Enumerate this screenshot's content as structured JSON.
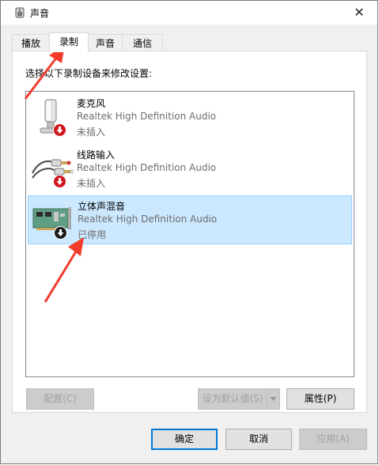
{
  "window": {
    "title": "声音",
    "close_glyph": "✕"
  },
  "tabs": [
    {
      "label": "播放"
    },
    {
      "label": "录制"
    },
    {
      "label": "声音"
    },
    {
      "label": "通信"
    }
  ],
  "active_tab": "录制",
  "recording": {
    "instructions": "选择以下录制设备来修改设置:",
    "devices": [
      {
        "name": "麦克风",
        "description": "Realtek High Definition Audio",
        "status": "未插入",
        "icon": "microphone-icon",
        "badge": "red-down-arrow",
        "selected": false
      },
      {
        "name": "线路输入",
        "description": "Realtek High Definition Audio",
        "status": "未插入",
        "icon": "line-in-cable-icon",
        "badge": "red-down-arrow",
        "selected": false
      },
      {
        "name": "立体声混音",
        "description": "Realtek High Definition Audio",
        "status": "已停用",
        "icon": "sound-card-icon",
        "badge": "black-down-arrow",
        "selected": true
      }
    ]
  },
  "panel_buttons": {
    "configure": "配置(C)",
    "set_default": "设为默认值(S)",
    "properties": "属性(P)"
  },
  "dialog_buttons": {
    "ok": "确定",
    "cancel": "取消",
    "apply": "应用(A)"
  },
  "colors": {
    "selection_bg": "#cce8ff",
    "selection_border": "#99d1ff",
    "annotation_arrow": "#f23c2c",
    "badge_red": "#d0161b"
  }
}
